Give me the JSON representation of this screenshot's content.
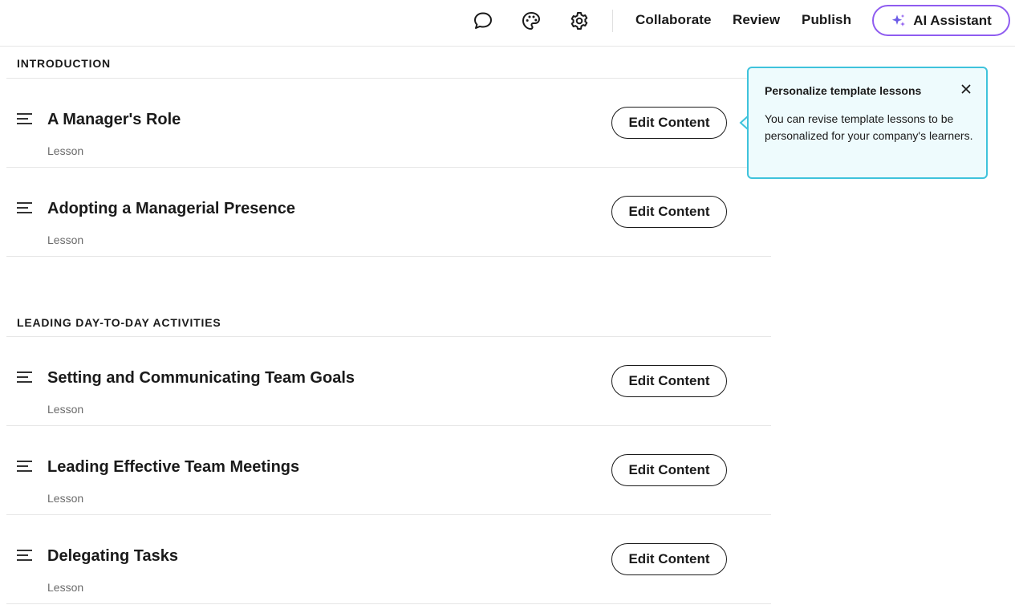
{
  "topbar": {
    "icons": {
      "comment": "comment-icon",
      "palette": "palette-icon",
      "settings": "gear-icon"
    },
    "links": {
      "collaborate": "Collaborate",
      "review": "Review",
      "publish": "Publish"
    },
    "ai_assistant_label": "AI Assistant",
    "accent_color": "#8f5cf0"
  },
  "sections": [
    {
      "title": "INTRODUCTION",
      "lessons": [
        {
          "title": "A Manager's Role",
          "type": "Lesson",
          "action": "Edit Content"
        },
        {
          "title": "Adopting a Managerial Presence",
          "type": "Lesson",
          "action": "Edit Content"
        }
      ]
    },
    {
      "title": "LEADING DAY-TO-DAY ACTIVITIES",
      "lessons": [
        {
          "title": "Setting and Communicating Team Goals",
          "type": "Lesson",
          "action": "Edit Content"
        },
        {
          "title": "Leading Effective Team Meetings",
          "type": "Lesson",
          "action": "Edit Content"
        },
        {
          "title": "Delegating Tasks",
          "type": "Lesson",
          "action": "Edit Content"
        }
      ]
    }
  ],
  "tooltip": {
    "title": "Personalize template lessons",
    "body": "You can revise template lessons to be personalized for your company's learners.",
    "border_color": "#3fc3dc",
    "background_color": "#eefbfd"
  }
}
